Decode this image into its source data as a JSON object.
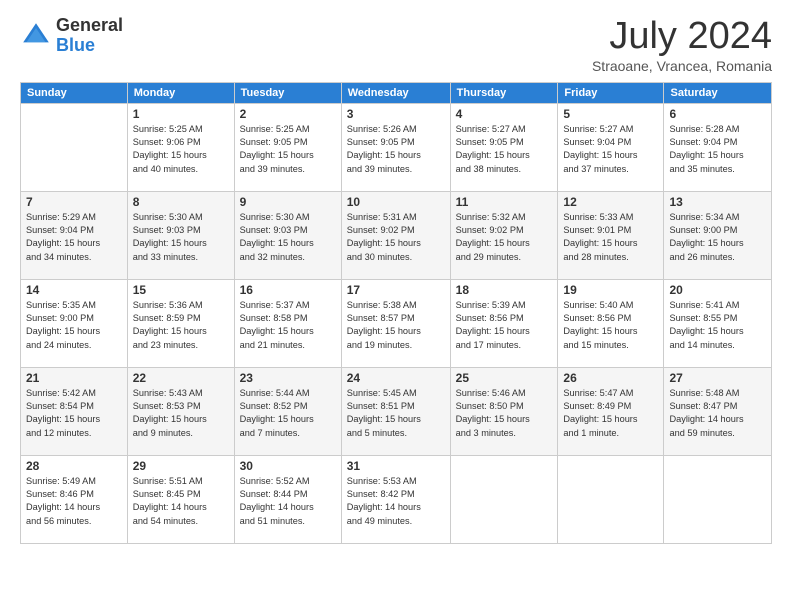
{
  "logo": {
    "general": "General",
    "blue": "Blue"
  },
  "title": "July 2024",
  "subtitle": "Straoane, Vrancea, Romania",
  "days_of_week": [
    "Sunday",
    "Monday",
    "Tuesday",
    "Wednesday",
    "Thursday",
    "Friday",
    "Saturday"
  ],
  "weeks": [
    [
      {
        "day": "",
        "info": ""
      },
      {
        "day": "1",
        "info": "Sunrise: 5:25 AM\nSunset: 9:06 PM\nDaylight: 15 hours\nand 40 minutes."
      },
      {
        "day": "2",
        "info": "Sunrise: 5:25 AM\nSunset: 9:05 PM\nDaylight: 15 hours\nand 39 minutes."
      },
      {
        "day": "3",
        "info": "Sunrise: 5:26 AM\nSunset: 9:05 PM\nDaylight: 15 hours\nand 39 minutes."
      },
      {
        "day": "4",
        "info": "Sunrise: 5:27 AM\nSunset: 9:05 PM\nDaylight: 15 hours\nand 38 minutes."
      },
      {
        "day": "5",
        "info": "Sunrise: 5:27 AM\nSunset: 9:04 PM\nDaylight: 15 hours\nand 37 minutes."
      },
      {
        "day": "6",
        "info": "Sunrise: 5:28 AM\nSunset: 9:04 PM\nDaylight: 15 hours\nand 35 minutes."
      }
    ],
    [
      {
        "day": "7",
        "info": "Sunrise: 5:29 AM\nSunset: 9:04 PM\nDaylight: 15 hours\nand 34 minutes."
      },
      {
        "day": "8",
        "info": "Sunrise: 5:30 AM\nSunset: 9:03 PM\nDaylight: 15 hours\nand 33 minutes."
      },
      {
        "day": "9",
        "info": "Sunrise: 5:30 AM\nSunset: 9:03 PM\nDaylight: 15 hours\nand 32 minutes."
      },
      {
        "day": "10",
        "info": "Sunrise: 5:31 AM\nSunset: 9:02 PM\nDaylight: 15 hours\nand 30 minutes."
      },
      {
        "day": "11",
        "info": "Sunrise: 5:32 AM\nSunset: 9:02 PM\nDaylight: 15 hours\nand 29 minutes."
      },
      {
        "day": "12",
        "info": "Sunrise: 5:33 AM\nSunset: 9:01 PM\nDaylight: 15 hours\nand 28 minutes."
      },
      {
        "day": "13",
        "info": "Sunrise: 5:34 AM\nSunset: 9:00 PM\nDaylight: 15 hours\nand 26 minutes."
      }
    ],
    [
      {
        "day": "14",
        "info": "Sunrise: 5:35 AM\nSunset: 9:00 PM\nDaylight: 15 hours\nand 24 minutes."
      },
      {
        "day": "15",
        "info": "Sunrise: 5:36 AM\nSunset: 8:59 PM\nDaylight: 15 hours\nand 23 minutes."
      },
      {
        "day": "16",
        "info": "Sunrise: 5:37 AM\nSunset: 8:58 PM\nDaylight: 15 hours\nand 21 minutes."
      },
      {
        "day": "17",
        "info": "Sunrise: 5:38 AM\nSunset: 8:57 PM\nDaylight: 15 hours\nand 19 minutes."
      },
      {
        "day": "18",
        "info": "Sunrise: 5:39 AM\nSunset: 8:56 PM\nDaylight: 15 hours\nand 17 minutes."
      },
      {
        "day": "19",
        "info": "Sunrise: 5:40 AM\nSunset: 8:56 PM\nDaylight: 15 hours\nand 15 minutes."
      },
      {
        "day": "20",
        "info": "Sunrise: 5:41 AM\nSunset: 8:55 PM\nDaylight: 15 hours\nand 14 minutes."
      }
    ],
    [
      {
        "day": "21",
        "info": "Sunrise: 5:42 AM\nSunset: 8:54 PM\nDaylight: 15 hours\nand 12 minutes."
      },
      {
        "day": "22",
        "info": "Sunrise: 5:43 AM\nSunset: 8:53 PM\nDaylight: 15 hours\nand 9 minutes."
      },
      {
        "day": "23",
        "info": "Sunrise: 5:44 AM\nSunset: 8:52 PM\nDaylight: 15 hours\nand 7 minutes."
      },
      {
        "day": "24",
        "info": "Sunrise: 5:45 AM\nSunset: 8:51 PM\nDaylight: 15 hours\nand 5 minutes."
      },
      {
        "day": "25",
        "info": "Sunrise: 5:46 AM\nSunset: 8:50 PM\nDaylight: 15 hours\nand 3 minutes."
      },
      {
        "day": "26",
        "info": "Sunrise: 5:47 AM\nSunset: 8:49 PM\nDaylight: 15 hours\nand 1 minute."
      },
      {
        "day": "27",
        "info": "Sunrise: 5:48 AM\nSunset: 8:47 PM\nDaylight: 14 hours\nand 59 minutes."
      }
    ],
    [
      {
        "day": "28",
        "info": "Sunrise: 5:49 AM\nSunset: 8:46 PM\nDaylight: 14 hours\nand 56 minutes."
      },
      {
        "day": "29",
        "info": "Sunrise: 5:51 AM\nSunset: 8:45 PM\nDaylight: 14 hours\nand 54 minutes."
      },
      {
        "day": "30",
        "info": "Sunrise: 5:52 AM\nSunset: 8:44 PM\nDaylight: 14 hours\nand 51 minutes."
      },
      {
        "day": "31",
        "info": "Sunrise: 5:53 AM\nSunset: 8:42 PM\nDaylight: 14 hours\nand 49 minutes."
      },
      {
        "day": "",
        "info": ""
      },
      {
        "day": "",
        "info": ""
      },
      {
        "day": "",
        "info": ""
      }
    ]
  ]
}
